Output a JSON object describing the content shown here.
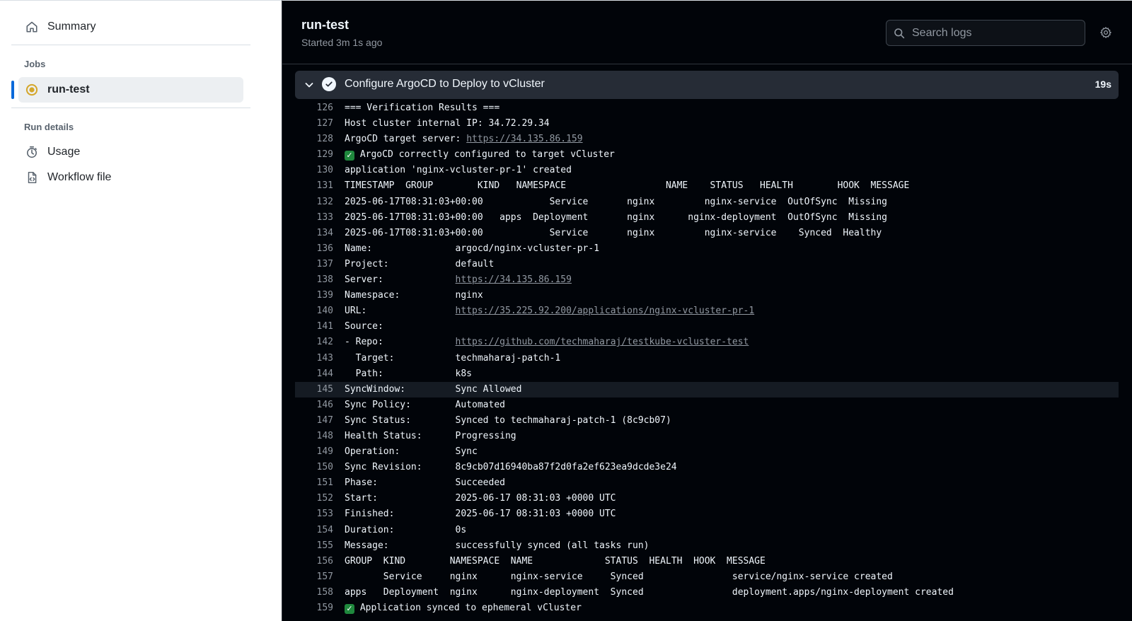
{
  "sidebar": {
    "summary_label": "Summary",
    "jobs_heading": "Jobs",
    "job_label": "run-test",
    "run_details_heading": "Run details",
    "usage_label": "Usage",
    "workflow_label": "Workflow file"
  },
  "header": {
    "title": "run-test",
    "subtitle": "Started 3m 1s ago",
    "search_placeholder": "Search logs"
  },
  "step": {
    "title": "Configure ArgoCD to Deploy to vCluster",
    "duration": "19s"
  },
  "colors": {
    "accent": "#0969da",
    "job_status": "#d4a72c",
    "success": "#1f883d"
  },
  "log": [
    {
      "n": "126",
      "t": "=== Verification Results ==="
    },
    {
      "n": "127",
      "t": "Host cluster internal IP: 34.72.29.34"
    },
    {
      "n": "128",
      "t": "ArgoCD target server: ",
      "link": "https://34.135.86.159"
    },
    {
      "n": "129",
      "t": " ArgoCD correctly configured to target vCluster",
      "check": true
    },
    {
      "n": "130",
      "t": "application 'nginx-vcluster-pr-1' created"
    },
    {
      "n": "131",
      "t": "TIMESTAMP  GROUP        KIND   NAMESPACE                  NAME    STATUS   HEALTH        HOOK  MESSAGE"
    },
    {
      "n": "132",
      "t": "2025-06-17T08:31:03+00:00            Service       nginx         nginx-service  OutOfSync  Missing"
    },
    {
      "n": "133",
      "t": "2025-06-17T08:31:03+00:00   apps  Deployment       nginx      nginx-deployment  OutOfSync  Missing"
    },
    {
      "n": "134",
      "t": "2025-06-17T08:31:03+00:00            Service       nginx         nginx-service    Synced  Healthy"
    },
    {
      "n": "136",
      "t": "Name:               argocd/nginx-vcluster-pr-1"
    },
    {
      "n": "137",
      "t": "Project:            default"
    },
    {
      "n": "138",
      "t": "Server:             ",
      "link": "https://34.135.86.159"
    },
    {
      "n": "139",
      "t": "Namespace:          nginx"
    },
    {
      "n": "140",
      "t": "URL:                ",
      "link": "https://35.225.92.200/applications/nginx-vcluster-pr-1"
    },
    {
      "n": "141",
      "t": "Source:"
    },
    {
      "n": "142",
      "t": "- Repo:             ",
      "link": "https://github.com/techmaharaj/testkube-vcluster-test"
    },
    {
      "n": "143",
      "t": "  Target:           techmaharaj-patch-1"
    },
    {
      "n": "144",
      "t": "  Path:             k8s"
    },
    {
      "n": "145",
      "t": "SyncWindow:         Sync Allowed",
      "hl": true
    },
    {
      "n": "146",
      "t": "Sync Policy:        Automated"
    },
    {
      "n": "147",
      "t": "Sync Status:        Synced to techmaharaj-patch-1 (8c9cb07)"
    },
    {
      "n": "148",
      "t": "Health Status:      Progressing"
    },
    {
      "n": "149",
      "t": "Operation:          Sync"
    },
    {
      "n": "150",
      "t": "Sync Revision:      8c9cb07d16940ba87f2d0fa2ef623ea9dcde3e24"
    },
    {
      "n": "151",
      "t": "Phase:              Succeeded"
    },
    {
      "n": "152",
      "t": "Start:              2025-06-17 08:31:03 +0000 UTC"
    },
    {
      "n": "153",
      "t": "Finished:           2025-06-17 08:31:03 +0000 UTC"
    },
    {
      "n": "154",
      "t": "Duration:           0s"
    },
    {
      "n": "155",
      "t": "Message:            successfully synced (all tasks run)"
    },
    {
      "n": "156",
      "t": "GROUP  KIND        NAMESPACE  NAME             STATUS  HEALTH  HOOK  MESSAGE"
    },
    {
      "n": "157",
      "t": "       Service     nginx      nginx-service     Synced                service/nginx-service created"
    },
    {
      "n": "158",
      "t": "apps   Deployment  nginx      nginx-deployment  Synced                deployment.apps/nginx-deployment created"
    },
    {
      "n": "159",
      "t": " Application synced to ephemeral vCluster",
      "check": true
    }
  ]
}
